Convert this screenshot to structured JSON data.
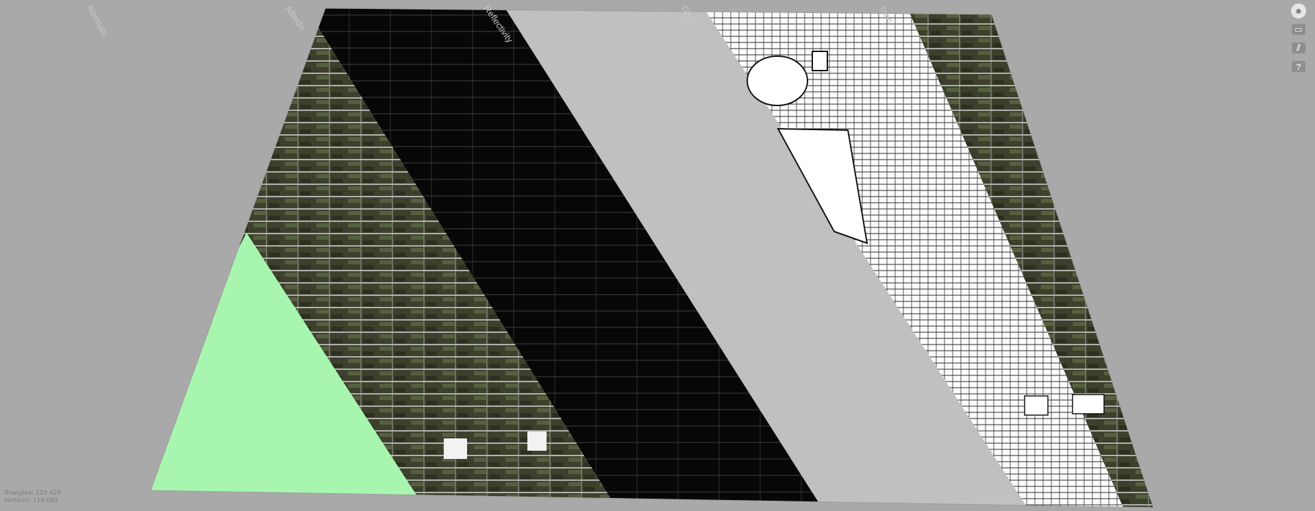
{
  "pass_labels": [
    "Normals",
    "Albedo",
    "Reflectivity",
    "Gloss",
    "Tone"
  ],
  "toolbar": {
    "buttons": [
      {
        "icon": "skull-icon"
      },
      {
        "icon": "layers-icon"
      },
      {
        "icon": "stripes-icon"
      },
      {
        "icon": "help-icon",
        "glyph": "?"
      }
    ]
  },
  "stats": {
    "triangles": "Triangles: 129 426",
    "vertices": "Vertices: 119 682"
  },
  "colors": {
    "background": "#a9a9a9",
    "normals": "#a8f5b0",
    "albedo_base": "#3b3f2c",
    "reflectivity": "#080808",
    "gloss": "#c0c0c0",
    "tone": "#ffffff"
  }
}
